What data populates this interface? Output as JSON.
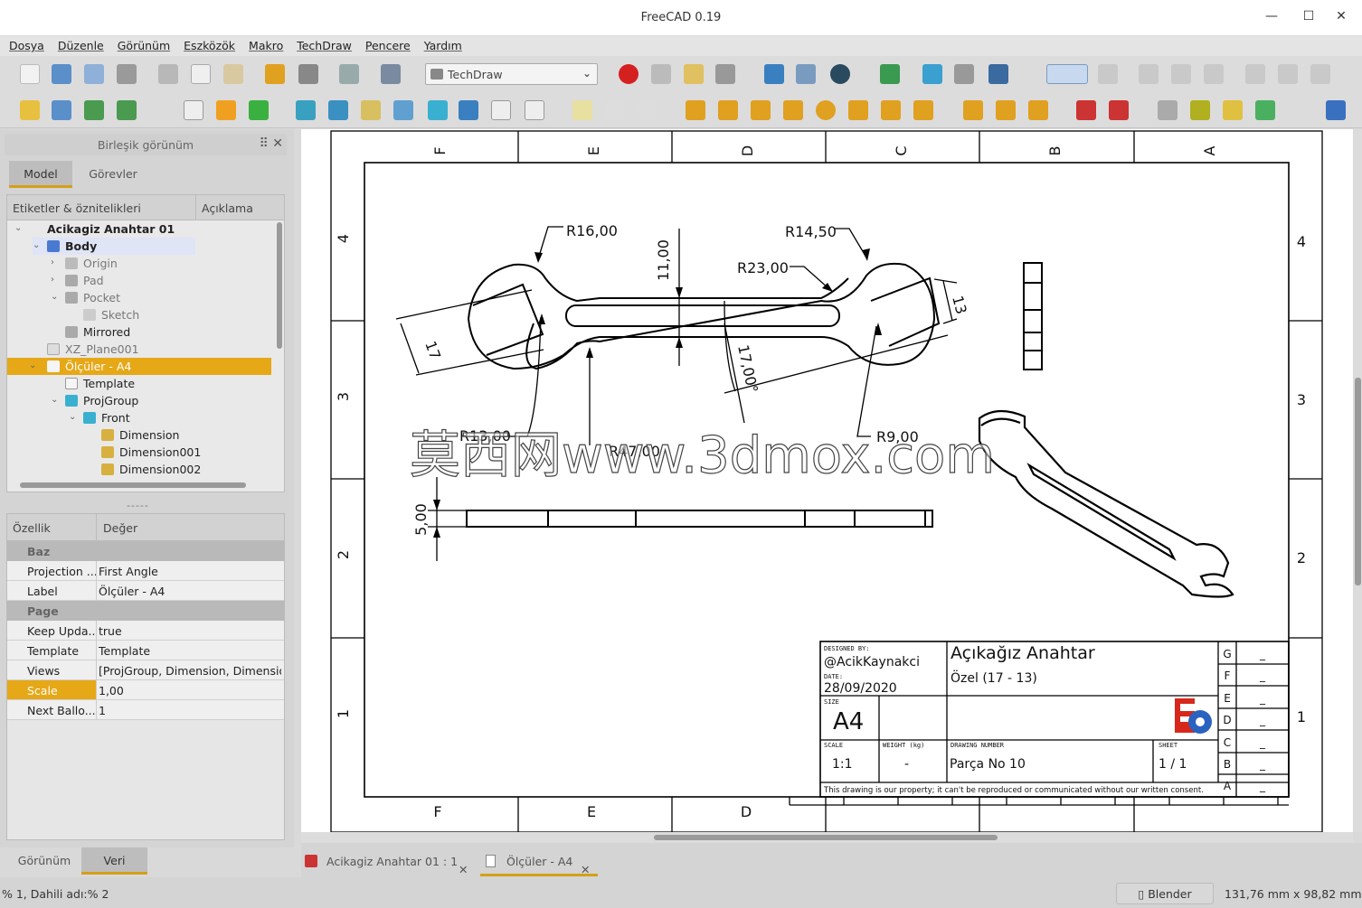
{
  "window": {
    "title": "FreeCAD 0.19",
    "minimize": "—",
    "maximize": "☐",
    "close": "✕"
  },
  "menu": [
    "Dosya",
    "Düzenle",
    "Görünüm",
    "Eszközök",
    "Makro",
    "TechDraw",
    "Pencere",
    "Yardım"
  ],
  "workbench_select": {
    "value": "TechDraw"
  },
  "combo_panel": {
    "title": "Birleşik görünüm",
    "tabs": [
      "Model",
      "Görevler"
    ]
  },
  "tree": {
    "headers": [
      "Etiketler & öznitelikleri",
      "Açıklama"
    ],
    "items": [
      {
        "label": "Acikagiz Anahtar 01",
        "bold": true
      },
      {
        "label": "Body",
        "bold": true
      },
      {
        "label": "Origin"
      },
      {
        "label": "Pad"
      },
      {
        "label": "Pocket"
      },
      {
        "label": "Sketch"
      },
      {
        "label": "Mirrored"
      },
      {
        "label": "XZ_Plane001"
      },
      {
        "label": "Ölçüler - A4"
      },
      {
        "label": "Template"
      },
      {
        "label": "ProjGroup"
      },
      {
        "label": "Front"
      },
      {
        "label": "Dimension"
      },
      {
        "label": "Dimension001"
      },
      {
        "label": "Dimension002"
      }
    ]
  },
  "splitter_handle": "-----",
  "properties": {
    "headers": [
      "Özellik",
      "Değer"
    ],
    "groups": [
      {
        "name": "Baz",
        "rows": [
          {
            "key": "Projection ...",
            "value": "First Angle"
          },
          {
            "key": "Label",
            "value": "Ölçüler - A4"
          }
        ]
      },
      {
        "name": "Page",
        "rows": [
          {
            "key": "Keep Upda...",
            "value": "true"
          },
          {
            "key": "Template",
            "value": "Template"
          },
          {
            "key": "Views",
            "value": "[ProjGroup, Dimension, Dimensio..."
          },
          {
            "key": "Scale",
            "value": "1,00"
          },
          {
            "key": "Next Ballo...",
            "value": "1"
          }
        ]
      }
    ]
  },
  "panel_bottom_tabs": [
    "Görünüm",
    "Veri"
  ],
  "drawing": {
    "zone_letters_top": [
      "F",
      "E",
      "D",
      "C",
      "B",
      "A"
    ],
    "zone_letters_bottom": [
      "F",
      "E",
      "D"
    ],
    "zone_numbers": [
      "4",
      "3",
      "2",
      "1"
    ],
    "dimensions": {
      "r16": "R16,00",
      "r14_5": "R14,50",
      "r23": "R23,00",
      "d11": "11,00",
      "d17": "17",
      "d13": "13",
      "a17": "17,00°",
      "r13": "R13,00",
      "r47": "R47,00",
      "r9": "R9,00",
      "d5": "5,00"
    },
    "watermark": "莫西网www.3dmox.com",
    "title_block": {
      "designed_by_label": "DESIGNED BY:",
      "designed_by": "@AcikKaynakci",
      "date_label": "DATE:",
      "date": "28/09/2020",
      "size_label": "SIZE",
      "size": "A4",
      "title": "Açıkağız Anahtar",
      "subtitle": "Özel (17 - 13)",
      "scale_label": "SCALE",
      "scale": "1:1",
      "weight_label": "WEIGHT (kg)",
      "weight": "-",
      "drawing_number_label": "DRAWING NUMBER",
      "drawing_number": "Parça No 10",
      "sheet_label": "SHEET",
      "sheet": "1 / 1",
      "notice": "This drawing is our property; it can't be reproduced or communicated without our written consent.",
      "revisions": [
        "G",
        "F",
        "E",
        "D",
        "C",
        "B",
        "A"
      ],
      "revision_value": "_"
    }
  },
  "doc_tabs": [
    {
      "label": "Acikagiz Anahtar 01 : 1",
      "close": "✕"
    },
    {
      "label": "Ölçüler - A4",
      "close": "✕"
    }
  ],
  "status": {
    "left": "% 1, Dahili adı:% 2",
    "navigation": "Blender",
    "dimensions": "131,76 mm x 98,82 mm"
  },
  "colors": {
    "selection": "#e6a817",
    "accent_underline": "#d4a017"
  }
}
